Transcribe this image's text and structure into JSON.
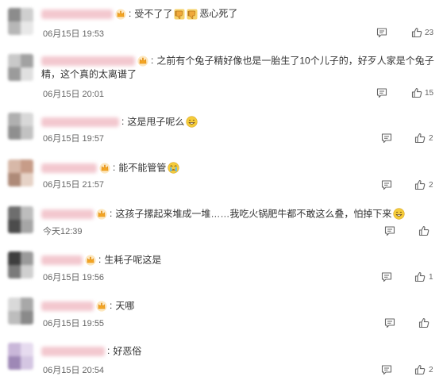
{
  "comments": [
    {
      "text_a": "受不了了",
      "text_b": "恶心死了",
      "time": "06月15日 19:53",
      "likes": "23",
      "emoji_a": "thumbs-down-icon",
      "emoji_b": "thumbs-down-icon"
    },
    {
      "text": "之前有个兔子精好像也是一胎生了10个儿子的，好歹人家是个兔子精，这个真的太离谱了",
      "time": "06月15日 20:01",
      "likes": "15"
    },
    {
      "text": "这是甩子呢么",
      "emoji": "grinning-face-icon",
      "time": "06月15日 19:57",
      "likes": "2"
    },
    {
      "text": "能不能管管",
      "emoji": "crying-face-icon",
      "time": "06月15日 21:57",
      "likes": "2"
    },
    {
      "text": "这孩子摞起来堆成一堆……我吃火锅肥牛都不敢这么叠，怕掉下来",
      "emoji": "grinning-face-icon",
      "time": "今天12:39",
      "likes": ""
    },
    {
      "text": "生耗子呢这是",
      "time": "06月15日 19:56",
      "likes": "1"
    },
    {
      "text": "天哪",
      "time": "06月15日 19:55",
      "likes": ""
    },
    {
      "text": "好恶俗",
      "time": "06月15日 20:54",
      "likes": "2"
    }
  ],
  "icons": {
    "reply": "reply-icon",
    "like": "like-icon",
    "badge": "crown-badge-icon"
  },
  "colors": {
    "badge": "#f4a623",
    "emoji_face": "#f5cc3a",
    "text": "#333333",
    "meta": "#666666"
  }
}
